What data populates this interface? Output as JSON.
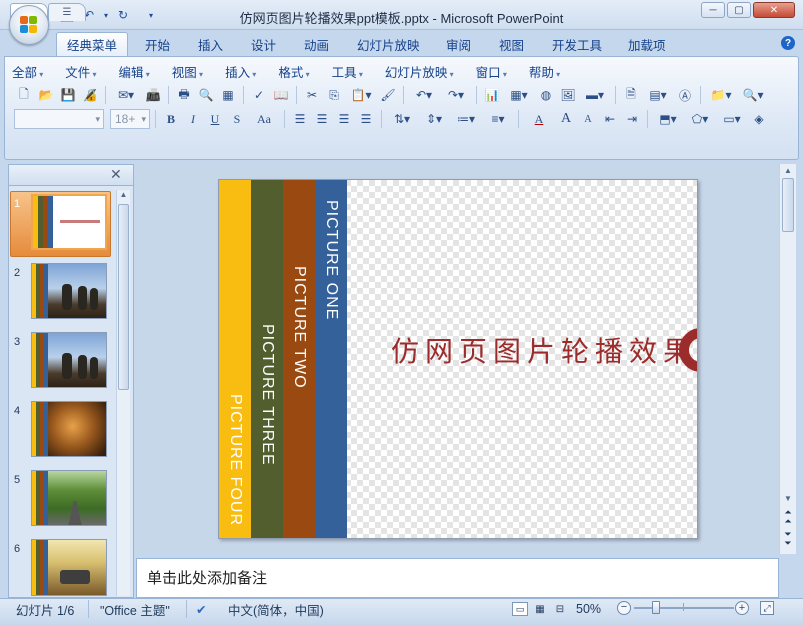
{
  "window": {
    "title": "仿网页图片轮播效果ppt模板.pptx - Microsoft PowerPoint",
    "min_label": "─",
    "max_label": "▢",
    "close_label": "✕"
  },
  "quick_access": {
    "save_icon": "save-icon",
    "undo_icon": "undo-icon",
    "redo_icon": "redo-icon",
    "customize_icon": "chevron-down-icon"
  },
  "tabs": [
    "经典菜单",
    "开始",
    "插入",
    "设计",
    "动画",
    "幻灯片放映",
    "审阅",
    "视图",
    "开发工具",
    "加载项"
  ],
  "help_label": "?",
  "menu": [
    "全部",
    "文件",
    "编辑",
    "视图",
    "插入",
    "格式",
    "工具",
    "幻灯片放映",
    "窗口",
    "帮助"
  ],
  "format_bar": {
    "font_name": "",
    "font_size": "18+",
    "bold": "B",
    "italic": "I",
    "underline": "U",
    "shadow": "S",
    "change_case": "Aa",
    "font_color": "A",
    "grow": "A",
    "shrink": "A"
  },
  "pane": {
    "slides_tab_icon": "slides-tab-icon",
    "outline_tab_icon": "outline-tab-icon",
    "close_label": "✕",
    "slide_numbers": [
      "1",
      "2",
      "3",
      "4",
      "5",
      "6"
    ]
  },
  "slide": {
    "bars": [
      {
        "label": "PICTURE  FOUR",
        "color": "#f9bd12"
      },
      {
        "label": "PICTURE  THREE",
        "color": "#525e2d"
      },
      {
        "label": "PICTURE  TWO",
        "color": "#9a4a10"
      },
      {
        "label": "PICTURE ONE",
        "color": "#35619b"
      }
    ],
    "title": "仿网页图片轮播效果",
    "title_color": "#9c2b2b"
  },
  "notes": {
    "placeholder": "单击此处添加备注"
  },
  "status": {
    "slide_info": "幻灯片 1/6",
    "theme": "\"Office 主题\"",
    "language": "中文(简体，中国)",
    "zoom": "50%"
  }
}
